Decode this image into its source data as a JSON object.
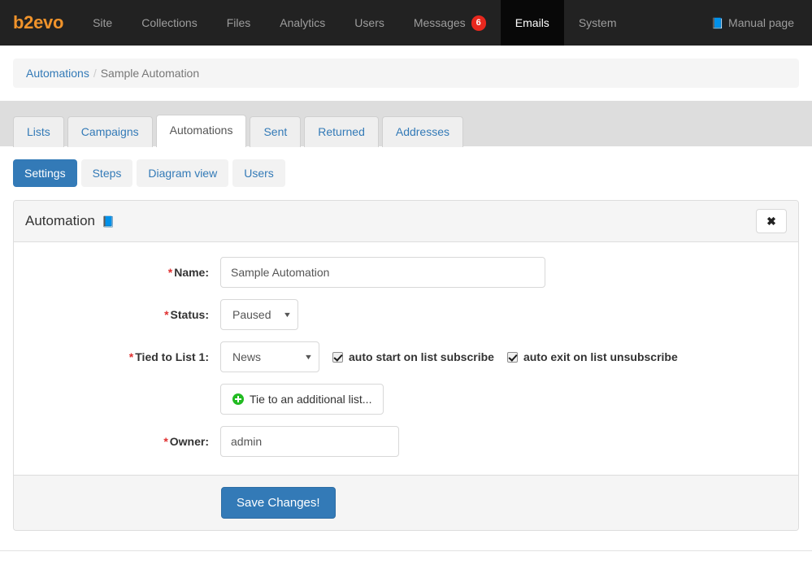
{
  "topnav": {
    "brand": "b2evo",
    "items": [
      {
        "label": "Site",
        "active": false
      },
      {
        "label": "Collections",
        "active": false
      },
      {
        "label": "Files",
        "active": false
      },
      {
        "label": "Analytics",
        "active": false
      },
      {
        "label": "Users",
        "active": false
      },
      {
        "label": "Messages",
        "active": false,
        "badge": "6"
      },
      {
        "label": "Emails",
        "active": true
      },
      {
        "label": "System",
        "active": false
      }
    ],
    "manual_page": "Manual page",
    "manual_icon": "book-icon",
    "brand_color": "#f0932b",
    "badge_color": "#e8281e",
    "active_bg": "#080808"
  },
  "breadcrumb": {
    "root": "Automations",
    "separator": "/",
    "current": "Sample Automation"
  },
  "tabs": [
    {
      "label": "Lists",
      "active": false
    },
    {
      "label": "Campaigns",
      "active": false
    },
    {
      "label": "Automations",
      "active": true
    },
    {
      "label": "Sent",
      "active": false
    },
    {
      "label": "Returned",
      "active": false
    },
    {
      "label": "Addresses",
      "active": false
    }
  ],
  "subtabs": [
    {
      "label": "Settings",
      "active": true
    },
    {
      "label": "Steps",
      "active": false
    },
    {
      "label": "Diagram view",
      "active": false
    },
    {
      "label": "Users",
      "active": false
    }
  ],
  "panel": {
    "title": "Automation",
    "title_icon": "manual-book-icon",
    "close_label": "✖",
    "form": {
      "name": {
        "required_mark": "*",
        "label": "Name:",
        "value": "Sample Automation"
      },
      "status": {
        "required_mark": "*",
        "label": "Status:",
        "value": "Paused",
        "caret": "▼"
      },
      "tied_list": {
        "required_mark": "*",
        "label": "Tied to List 1:",
        "value": "News",
        "caret": "▼",
        "auto_start_label": "auto start on list subscribe",
        "auto_start_checked": true,
        "auto_exit_label": "auto exit on list unsubscribe",
        "auto_exit_checked": true
      },
      "add_list_button": "Tie to an additional list...",
      "owner": {
        "required_mark": "*",
        "label": "Owner:",
        "value": "admin"
      }
    },
    "save_button": "Save Changes!",
    "accent_color": "#337ab7"
  }
}
